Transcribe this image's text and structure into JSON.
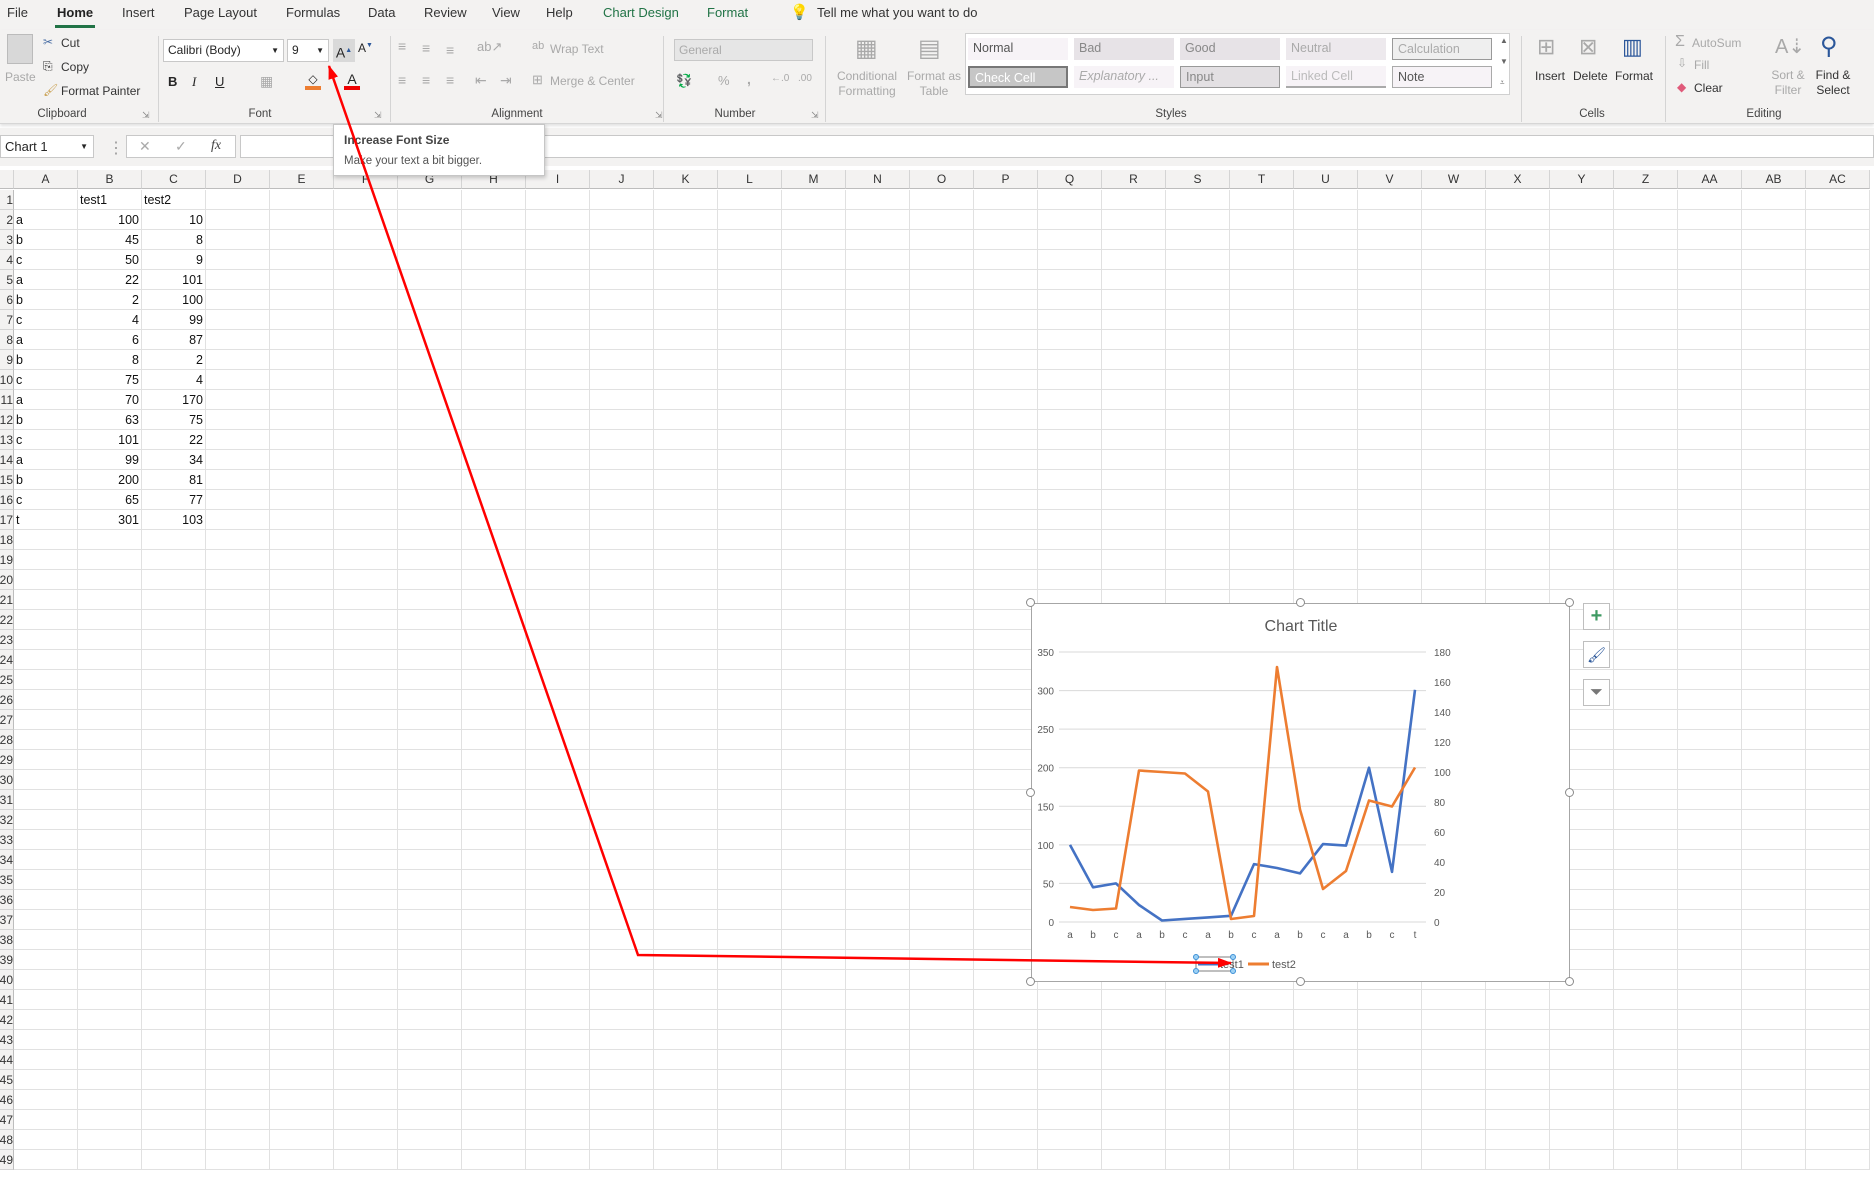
{
  "menu": {
    "tabs": [
      "File",
      "Home",
      "Insert",
      "Page Layout",
      "Formulas",
      "Data",
      "Review",
      "View",
      "Help",
      "Chart Design",
      "Format"
    ],
    "active_tab": "Home",
    "tell_me": "Tell me what you want to do"
  },
  "ribbon": {
    "clipboard": {
      "label": "Clipboard",
      "paste": "Paste",
      "cut": "Cut",
      "copy": "Copy",
      "format_painter": "Format Painter"
    },
    "font": {
      "label": "Font",
      "font_name": "Calibri (Body)",
      "font_size": "9",
      "bold": "B",
      "italic": "I",
      "underline": "U"
    },
    "alignment": {
      "label": "Alignment",
      "wrap_text": "Wrap Text",
      "merge_center": "Merge & Center"
    },
    "number": {
      "label": "Number",
      "format": "General",
      "percent": "%",
      "comma": ","
    },
    "styles": {
      "label": "Styles",
      "conditional_formatting": [
        "Conditional",
        "Formatting"
      ],
      "format_as_table": [
        "Format as",
        "Table"
      ],
      "gallery": [
        "Normal",
        "Bad",
        "Good",
        "Neutral",
        "Calculation",
        "Check Cell",
        "Explanatory ...",
        "Input",
        "Linked Cell",
        "Note"
      ]
    },
    "cells": {
      "label": "Cells",
      "insert": "Insert",
      "delete": "Delete",
      "format": "Format"
    },
    "editing": {
      "label": "Editing",
      "autosum": "AutoSum",
      "fill": "Fill",
      "clear": "Clear",
      "sort_filter": [
        "Sort &",
        "Filter"
      ],
      "find_select": [
        "Find &",
        "Select"
      ]
    }
  },
  "formula_bar": {
    "name_box": "Chart 1",
    "formula": ""
  },
  "tooltip": {
    "title": "Increase Font Size",
    "description": "Make your text a bit bigger."
  },
  "sheet": {
    "columns": [
      "A",
      "B",
      "C",
      "D",
      "E",
      "F",
      "G",
      "H",
      "I",
      "J",
      "K",
      "L",
      "M",
      "N",
      "O",
      "P",
      "Q",
      "R",
      "S",
      "T",
      "U",
      "V",
      "W",
      "X",
      "Y",
      "Z",
      "AA",
      "AB",
      "AC"
    ],
    "row_count": 49,
    "header_row": [
      "",
      "test1",
      "test2"
    ],
    "rows": [
      [
        "a",
        100,
        10
      ],
      [
        "b",
        45,
        8
      ],
      [
        "c",
        50,
        9
      ],
      [
        "a",
        22,
        101
      ],
      [
        "b",
        2,
        100
      ],
      [
        "c",
        4,
        99
      ],
      [
        "a",
        6,
        87
      ],
      [
        "b",
        8,
        2
      ],
      [
        "c",
        75,
        4
      ],
      [
        "a",
        70,
        170
      ],
      [
        "b",
        63,
        75
      ],
      [
        "c",
        101,
        22
      ],
      [
        "a",
        99,
        34
      ],
      [
        "b",
        200,
        81
      ],
      [
        "c",
        65,
        77
      ],
      [
        "t",
        301,
        103
      ]
    ]
  },
  "colors": {
    "accent": "#217346",
    "series1": "#4472c4",
    "series2": "#ed7d31",
    "annotation": "#ff0000"
  },
  "chart_data": {
    "type": "line",
    "title": "Chart Title",
    "categories": [
      "a",
      "b",
      "c",
      "a",
      "b",
      "c",
      "a",
      "b",
      "c",
      "a",
      "b",
      "c",
      "a",
      "b",
      "c",
      "t"
    ],
    "series": [
      {
        "name": "test1",
        "axis": "primary",
        "values": [
          100,
          45,
          50,
          22,
          2,
          4,
          6,
          8,
          75,
          70,
          63,
          101,
          99,
          200,
          65,
          301
        ]
      },
      {
        "name": "test2",
        "axis": "secondary",
        "values": [
          10,
          8,
          9,
          101,
          100,
          99,
          87,
          2,
          4,
          170,
          75,
          22,
          34,
          81,
          77,
          103
        ]
      }
    ],
    "ylim": [
      0,
      350
    ],
    "yticks": [
      0,
      50,
      100,
      150,
      200,
      250,
      300,
      350
    ],
    "y2lim": [
      0,
      180
    ],
    "y2ticks": [
      0,
      20,
      40,
      60,
      80,
      100,
      120,
      140,
      160,
      180
    ],
    "grid": true,
    "legend": "bottom"
  }
}
